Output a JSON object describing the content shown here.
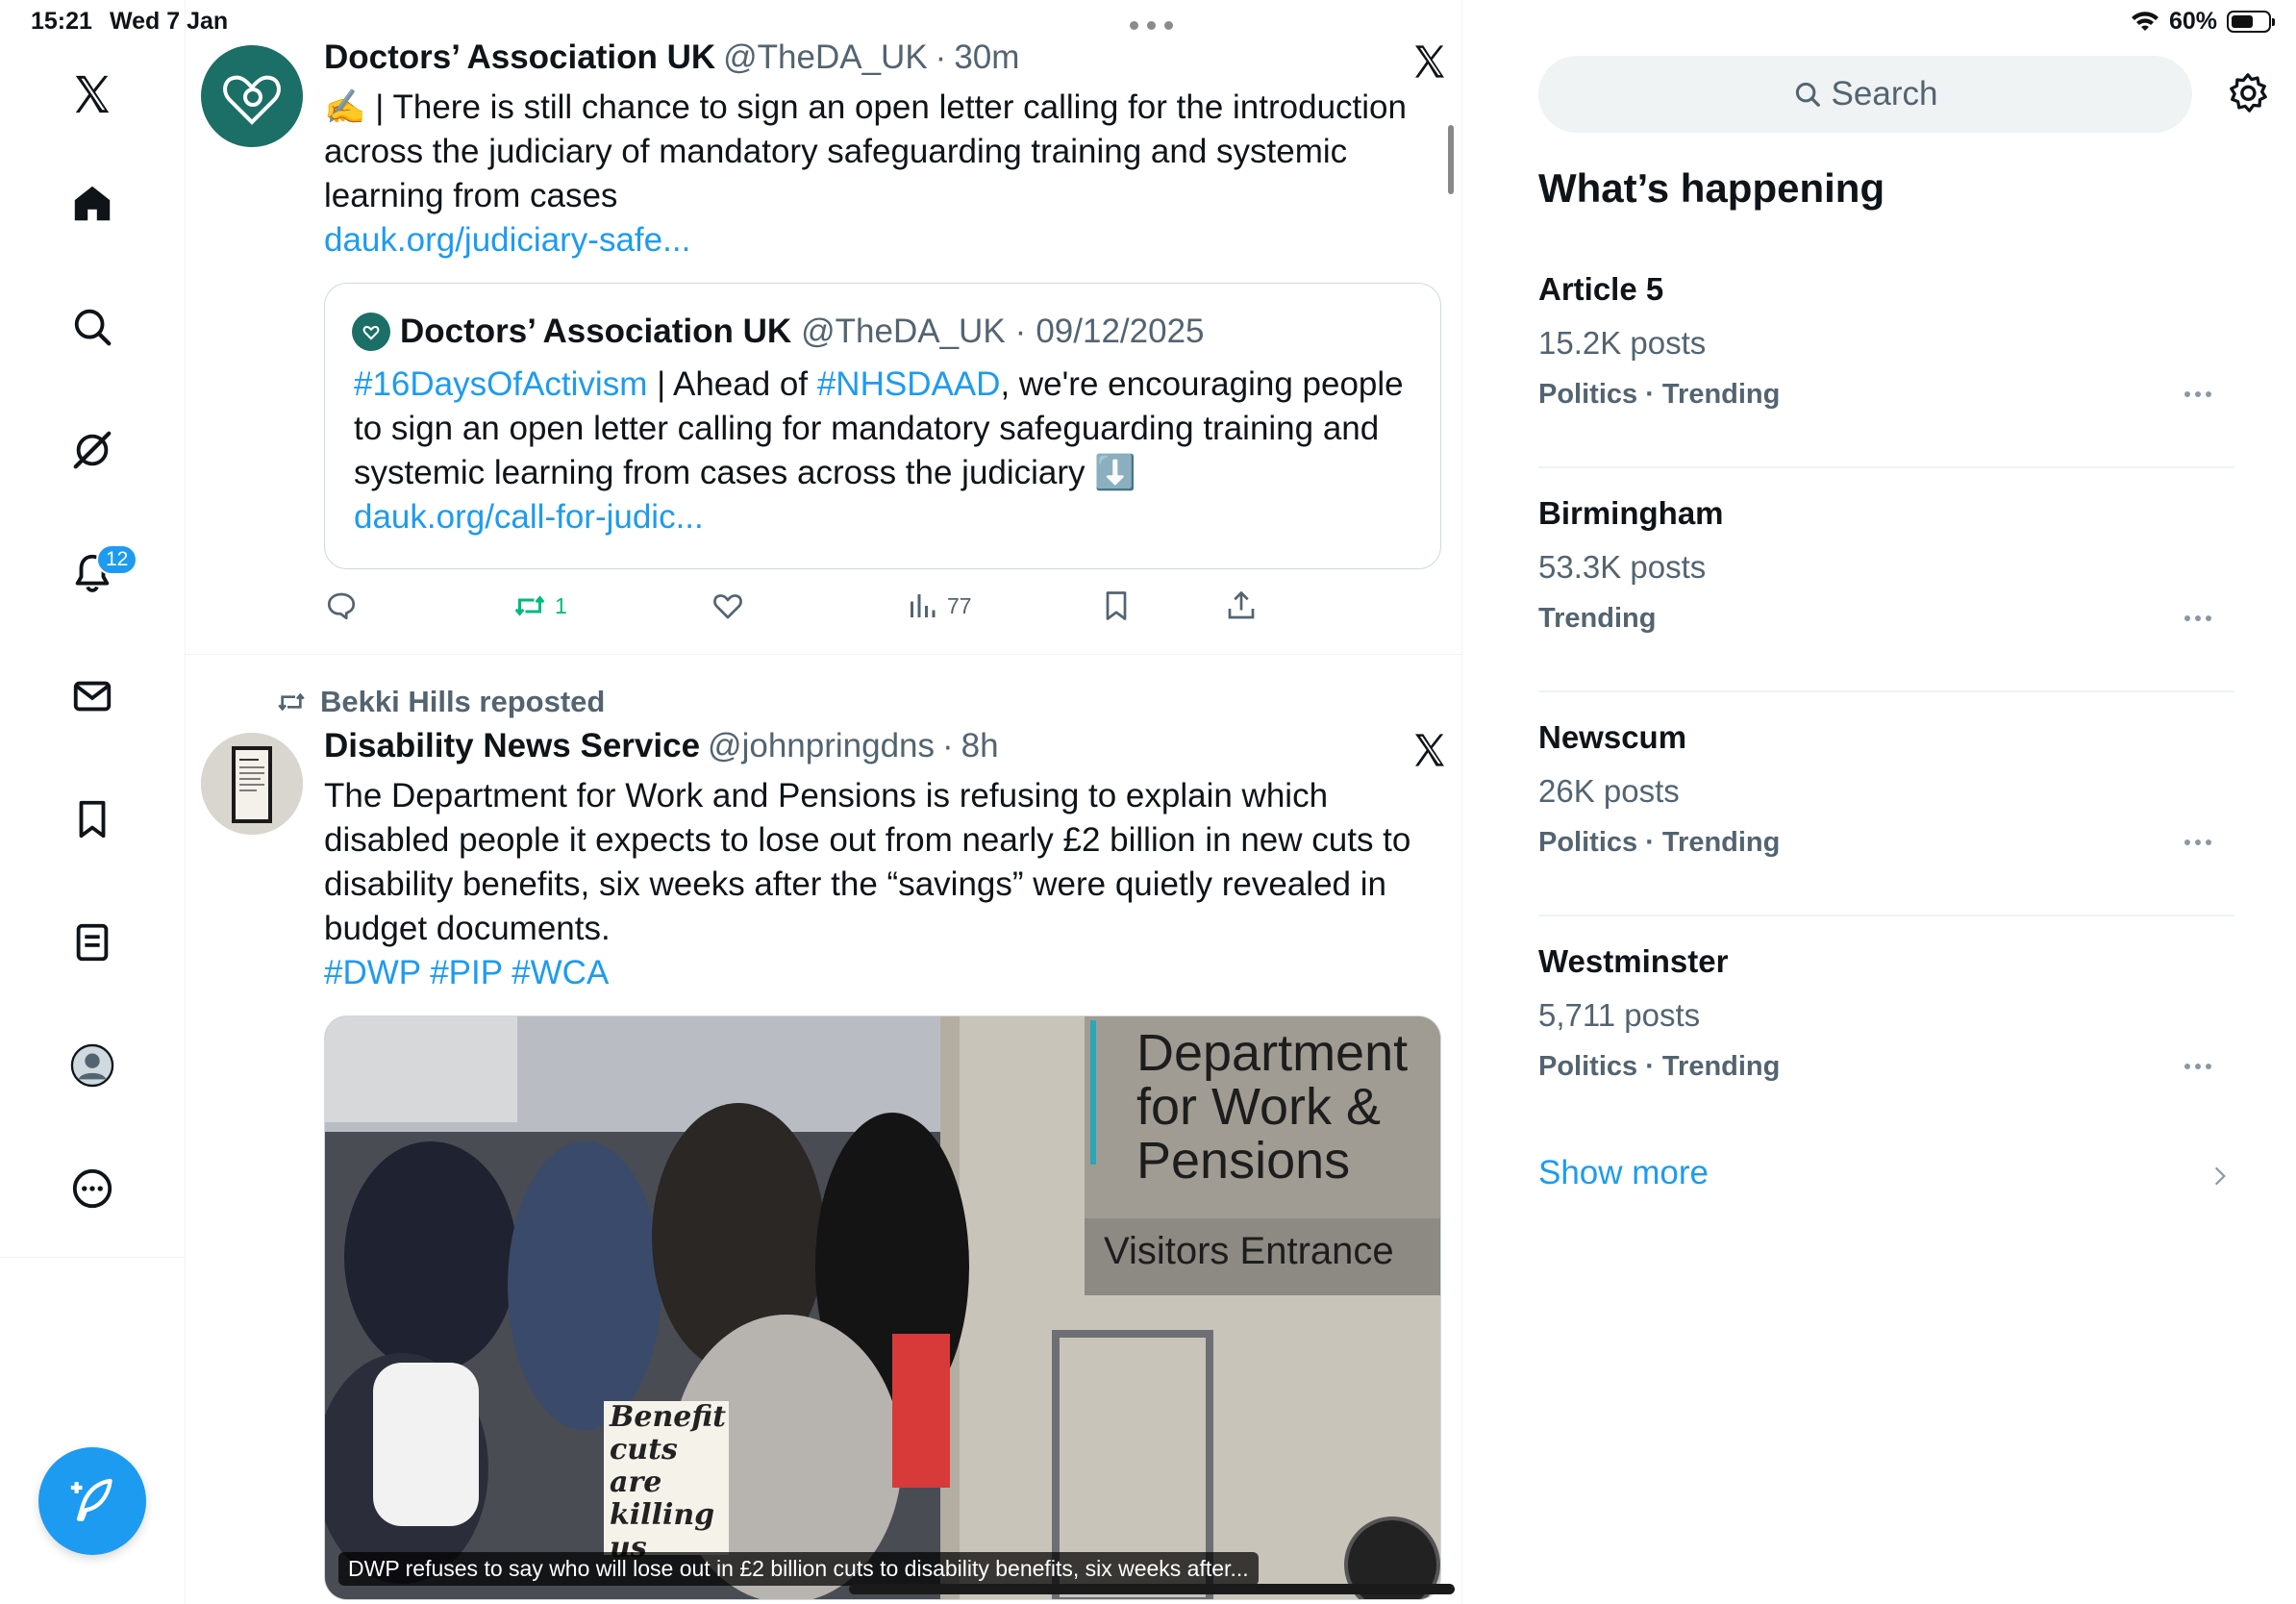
{
  "status_bar": {
    "time": "15:21",
    "date": "Wed 7 Jan",
    "battery": "60%",
    "battery_level": 0.6
  },
  "nav": {
    "notifications_badge": "12"
  },
  "timeline": {
    "tweets": [
      {
        "name": "Doctors’ Association UK",
        "handle": "@TheDA_UK",
        "sep": "·",
        "time": "30m",
        "body_prefix": "✍️ | There is still chance to sign an open letter calling for the introduction across the judiciary of mandatory safeguarding training and systemic learning from cases",
        "body_link": "dauk.org/judiciary-safe...",
        "quote": {
          "name": "Doctors’ Association UK",
          "handle": "@TheDA_UK",
          "sep": "·",
          "date": "09/12/2025",
          "hashtag1": "#16DaysOfActivism",
          "text1": " | Ahead of ",
          "hashtag2": "#NHSDAAD",
          "text2": ", we're encouraging people to sign an open letter calling for mandatory safeguarding training and systemic learning from cases across the judiciary ⬇️",
          "link": "dauk.org/call-for-judic..."
        },
        "actions": {
          "retweets": "1",
          "views": "77"
        }
      },
      {
        "repost_by": "Bekki Hills reposted",
        "name": "Disability News Service",
        "handle": "@johnpringdns",
        "sep": "·",
        "time": "8h",
        "body": "The Department for Work and Pensions is refusing to explain which disabled people it expects to lose out from nearly £2 billion in new cuts to disability benefits, six weeks after the “savings” were quietly revealed in budget documents.",
        "hashtags": "#DWP #PIP #WCA",
        "media_caption": "DWP refuses to say who will lose out in £2 billion cuts to disability benefits, six weeks after...",
        "sign_line1": "Department",
        "sign_line2": "for Work &",
        "sign_line3": "Pensions",
        "sign_entrance": "Visitors Entrance",
        "placard": "Benefit cuts are killing us"
      }
    ]
  },
  "sidebar": {
    "search_placeholder": "Search",
    "title": "What’s happening",
    "trends": [
      {
        "name": "Article 5",
        "count": "15.2K posts",
        "category": "Politics · Trending"
      },
      {
        "name": "Birmingham",
        "count": "53.3K posts",
        "category": "Trending"
      },
      {
        "name": "Newscum",
        "count": "26K posts",
        "category": "Politics · Trending"
      },
      {
        "name": "Westminster",
        "count": "5,711 posts",
        "category": "Politics · Trending"
      }
    ],
    "show_more": "Show more"
  },
  "colors": {
    "accent": "#1d9bf0",
    "retweet": "#00ba7c",
    "muted": "#536471",
    "avatar_teal": "#1b6f66"
  }
}
